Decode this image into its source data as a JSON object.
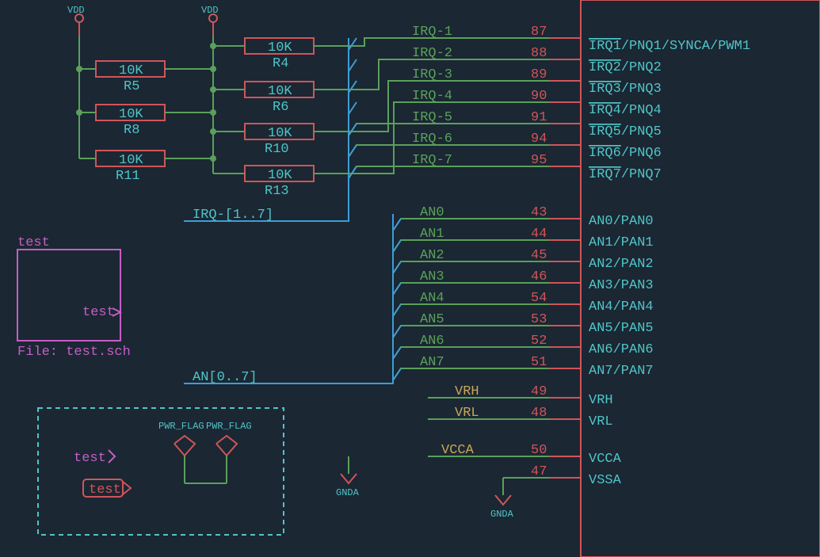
{
  "power": {
    "vdd1": "VDD",
    "vdd2": "VDD"
  },
  "resistors": {
    "r4": {
      "val": "10K",
      "name": "R4"
    },
    "r5": {
      "val": "10K",
      "name": "R5"
    },
    "r6": {
      "val": "10K",
      "name": "R6"
    },
    "r8": {
      "val": "10K",
      "name": "R8"
    },
    "r10": {
      "val": "10K",
      "name": "R10"
    },
    "r11": {
      "val": "10K",
      "name": "R11"
    },
    "r13": {
      "val": "10K",
      "name": "R13"
    }
  },
  "buses": {
    "irq": "IRQ-[1..7]",
    "an": "AN[0..7]"
  },
  "nets": {
    "irq1": "IRQ-1",
    "irq2": "IRQ-2",
    "irq3": "IRQ-3",
    "irq4": "IRQ-4",
    "irq5": "IRQ-5",
    "irq6": "IRQ-6",
    "irq7": "IRQ-7",
    "an0": "AN0",
    "an1": "AN1",
    "an2": "AN2",
    "an3": "AN3",
    "an4": "AN4",
    "an5": "AN5",
    "an6": "AN6",
    "an7": "AN7",
    "vrh": "VRH",
    "vrl": "VRL",
    "vcca": "VCCA"
  },
  "pins": {
    "p87": "87",
    "p88": "88",
    "p89": "89",
    "p90": "90",
    "p91": "91",
    "p94": "94",
    "p95": "95",
    "p43": "43",
    "p44": "44",
    "p45": "45",
    "p46": "46",
    "p54": "54",
    "p53": "53",
    "p52": "52",
    "p51": "51",
    "p49": "49",
    "p48": "48",
    "p50": "50",
    "p47": "47"
  },
  "pinlabels": {
    "irq1_a": "IRQ1",
    "irq1_b": "/PNQ1/SYNCA/PWM1",
    "irq2_a": "IRQ2",
    "irq2_b": "/PNQ2",
    "irq3_a": "IRQ3",
    "irq3_b": "/PNQ3",
    "irq4_a": "IRQ4",
    "irq4_b": "/PNQ4",
    "irq5_a": "IRQ5",
    "irq5_b": "/PNQ5",
    "irq6_a": "IRQ6",
    "irq6_b": "/PNQ6",
    "irq7_a": "IRQ7",
    "irq7_b": "/PNQ7",
    "an0": "AN0/PAN0",
    "an1": "AN1/PAN1",
    "an2": "AN2/PAN2",
    "an3": "AN3/PAN3",
    "an4": "AN4/PAN4",
    "an5": "AN5/PAN5",
    "an6": "AN6/PAN6",
    "an7": "AN7/PAN7",
    "vrh": "VRH",
    "vrl": "VRL",
    "vcca": "VCCA",
    "vssa": "VSSA"
  },
  "sheet": {
    "title": "test",
    "port": "test",
    "file": "File: test.sch"
  },
  "pwr": {
    "flag1": "PWR_FLAG",
    "flag2": "PWR_FLAG",
    "gnda1": "GNDA",
    "gnda2": "GNDA"
  },
  "labels": {
    "testout": "test",
    "testbox": "test"
  }
}
